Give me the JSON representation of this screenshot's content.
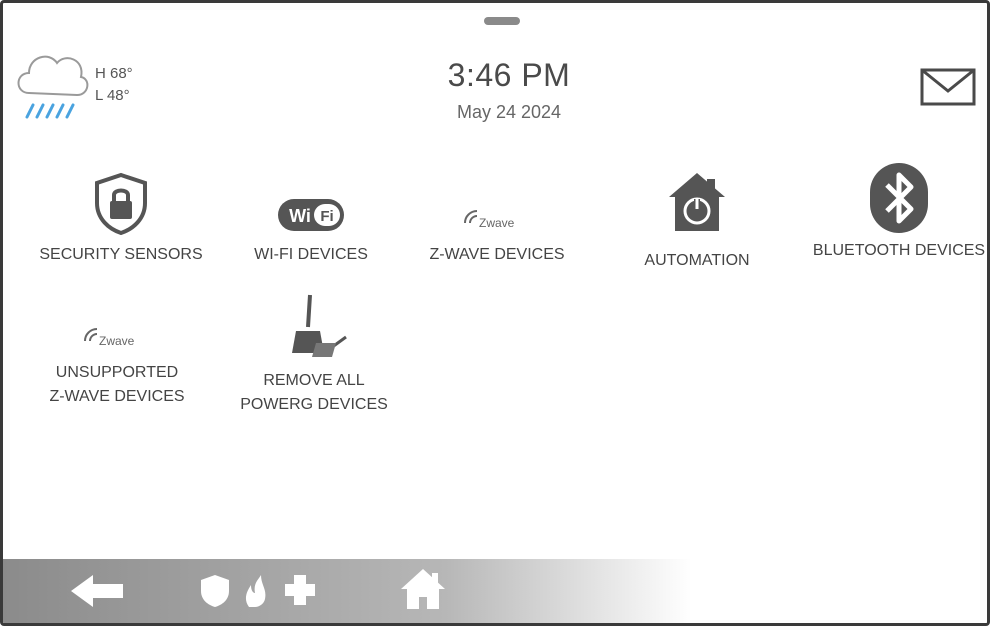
{
  "weather": {
    "high": "H 68°",
    "low": "L 48°",
    "icon": "rain-cloud-icon"
  },
  "clock": {
    "time": "3:46 PM",
    "date": "May 24 2024"
  },
  "tiles": [
    {
      "label": "SECURITY SENSORS",
      "icon": "shield-lock-icon"
    },
    {
      "label": "WI-FI DEVICES",
      "icon": "wifi-icon"
    },
    {
      "label": "Z-WAVE DEVICES",
      "icon": "zwave-icon",
      "icon_text": "Zwave"
    },
    {
      "label": "AUTOMATION",
      "icon": "home-automation-icon"
    },
    {
      "label": "BLUETOOTH DEVICES",
      "icon": "bluetooth-icon"
    },
    {
      "label": "UNSUPPORTED Z-WAVE DEVICES",
      "icon": "zwave-icon",
      "icon_text": "Zwave"
    },
    {
      "label": "REMOVE ALL POWERG DEVICES",
      "icon": "broom-icon"
    }
  ],
  "icons": {
    "mail": "mail-icon",
    "back": "back-arrow-icon",
    "shield": "shield-icon",
    "flame": "fire-icon",
    "plus": "plus-icon",
    "home": "home-icon"
  },
  "colors": {
    "icon_fill": "#5a5a5a",
    "text": "#444444",
    "bottom_bar": "#9a9a9a",
    "rain": "#4aa3df"
  }
}
